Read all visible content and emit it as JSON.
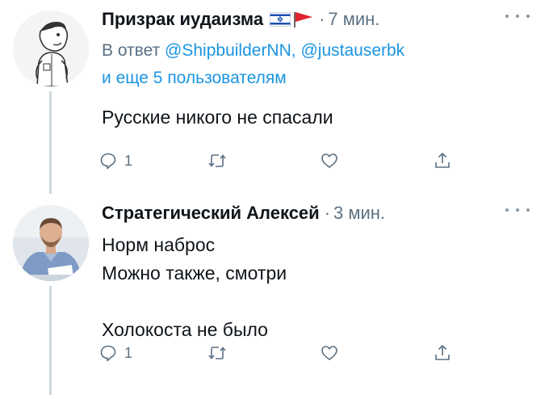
{
  "tweets": [
    {
      "display_name": "Призрак иудаизма",
      "badge_icons": [
        "israel-flag-icon",
        "red-pennant-icon"
      ],
      "separator": "·",
      "time": "7 мин.",
      "reply_to": {
        "prefix": "В ответ",
        "mention1": "@ShipbuilderNN",
        "sep": ",",
        "mention2": "@justauserbk",
        "suffix": "и еще 5 пользователям"
      },
      "body_lines": [
        "Русские никого не спасали"
      ],
      "actions": {
        "reply_count": "1"
      },
      "colors": {
        "name": "#0f1419",
        "meta": "#5b7083",
        "mention": "#1b95e0",
        "thread_line": "#cfd9de"
      }
    },
    {
      "display_name": "Стратегический Алексей",
      "separator": "·",
      "time": "3 мин.",
      "body_lines": [
        "Норм наброс",
        "Можно также, смотри",
        "",
        "Холокоста не было"
      ],
      "actions": {
        "reply_count": "1"
      }
    }
  ]
}
